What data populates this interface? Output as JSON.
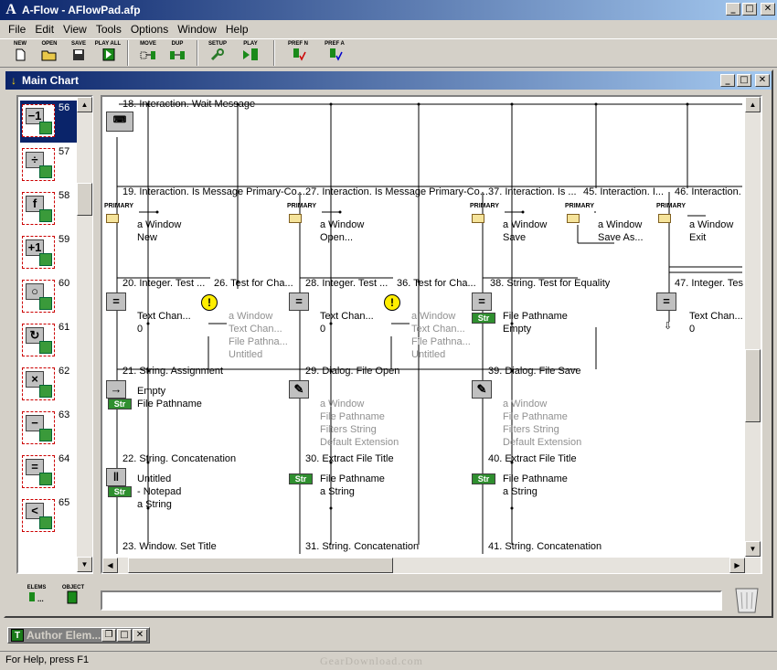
{
  "window": {
    "title": "A-Flow - AFlowPad.afp",
    "minimize": "_",
    "maximize": "□",
    "close": "✕"
  },
  "menu": [
    "File",
    "Edit",
    "View",
    "Tools",
    "Options",
    "Window",
    "Help"
  ],
  "toolbar": {
    "new": "NEW",
    "open": "OPEN",
    "save": "SAVE",
    "play_all": "PLAY ALL",
    "move": "MOVE",
    "dup": "DUP",
    "setup": "SETUP",
    "play": "PLAY",
    "pref_n": "PREF N",
    "pref_a": "PREF A"
  },
  "child_window": {
    "title": "Main Chart"
  },
  "palette": [
    {
      "symbol": "−1",
      "number": "56",
      "selected": true
    },
    {
      "symbol": "÷",
      "number": "57"
    },
    {
      "symbol": "f",
      "number": "58"
    },
    {
      "symbol": "+1",
      "number": "59"
    },
    {
      "symbol": "○",
      "number": "60"
    },
    {
      "symbol": "↻",
      "number": "61"
    },
    {
      "symbol": "×",
      "number": "62"
    },
    {
      "symbol": "−",
      "number": "63"
    },
    {
      "symbol": "=",
      "number": "64"
    },
    {
      "symbol": "<",
      "number": "65"
    }
  ],
  "chart": {
    "primary_label": "PRIMARY",
    "nodes": [
      {
        "id": "n18",
        "text": "18. Interaction. Wait Message"
      },
      {
        "id": "n19",
        "text": "19. Interaction. Is Message Primary-Co..."
      },
      {
        "id": "n27",
        "text": "27. Interaction. Is Message Primary-Co..."
      },
      {
        "id": "n37",
        "text": "37. Interaction. Is ..."
      },
      {
        "id": "n45",
        "text": "45. Interaction. I..."
      },
      {
        "id": "n46",
        "text": "46. Interaction."
      },
      {
        "id": "n20",
        "text": "20. Integer. Test ..."
      },
      {
        "id": "n26",
        "text": "26. Test for Cha..."
      },
      {
        "id": "n28",
        "text": "28. Integer. Test ..."
      },
      {
        "id": "n36",
        "text": "36. Test for Cha..."
      },
      {
        "id": "n38",
        "text": "38. String. Test for Equality"
      },
      {
        "id": "n47",
        "text": "47. Integer. Tes"
      },
      {
        "id": "n21",
        "text": "21. String. Assignment"
      },
      {
        "id": "n29",
        "text": "29. Dialog. File Open"
      },
      {
        "id": "n39",
        "text": "39. Dialog. File Save"
      },
      {
        "id": "n22",
        "text": "22. String. Concatenation"
      },
      {
        "id": "n30",
        "text": "30. Extract File Title"
      },
      {
        "id": "n40",
        "text": "40. Extract File Title"
      },
      {
        "id": "n23",
        "text": "23. Window. Set Title"
      },
      {
        "id": "n31",
        "text": "31. String. Concatenation"
      },
      {
        "id": "n41",
        "text": "41. String. Concatenation"
      }
    ],
    "params": {
      "p19": [
        "a Window",
        "New"
      ],
      "p27": [
        "a Window",
        "Open..."
      ],
      "p37": [
        "a Window",
        "Save"
      ],
      "p45": [
        "a Window",
        "Save As..."
      ],
      "p46": [
        "a Window",
        "Exit"
      ],
      "p20": [
        "Text Chan...",
        "0"
      ],
      "p26": [
        "a Window",
        "Text Chan...",
        "File Pathna...",
        "Untitled"
      ],
      "p28": [
        "Text Chan...",
        "0"
      ],
      "p36": [
        "a Window",
        "Text Chan...",
        "File Pathna...",
        "Untitled"
      ],
      "p38": [
        "File Pathname",
        "Empty"
      ],
      "p47": [
        "Text Chan...",
        "0"
      ],
      "p21": [
        "Empty",
        "File Pathname"
      ],
      "p29": [
        "a Window",
        "File Pathname",
        "Filters String",
        "Default Extension"
      ],
      "p39": [
        "a Window",
        "File Pathname",
        "Filters String",
        "Default Extension"
      ],
      "p22": [
        "Untitled",
        "- Notepad",
        "a String"
      ],
      "p30": [
        "File Pathname",
        "a String"
      ],
      "p40": [
        "File Pathname",
        "a String"
      ]
    }
  },
  "bottom": {
    "elems": "ELEMS",
    "object": "OBJECT"
  },
  "minimized": {
    "title": "Author Elem..."
  },
  "status": {
    "text": "For Help, press F1"
  },
  "watermark": "GearDownload.com"
}
